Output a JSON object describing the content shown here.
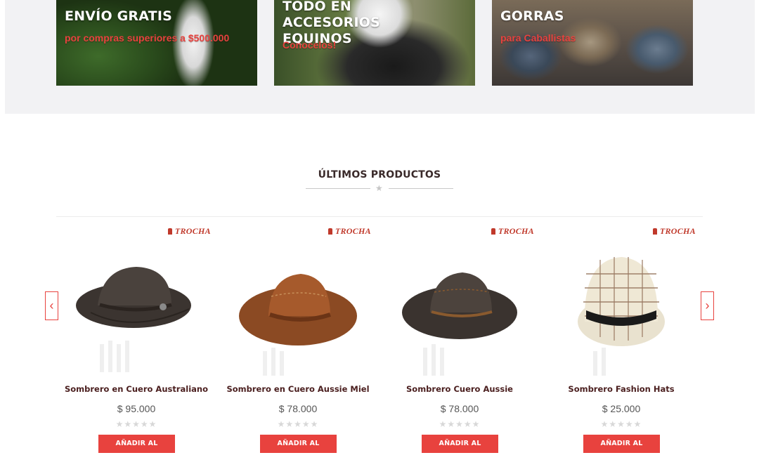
{
  "promos": [
    {
      "title": "ENVÍO GRATIS",
      "subtitle": "por compras superiores a $500.000"
    },
    {
      "title": "TODO EN ACCESORIOS EQUINOS",
      "subtitle": "Conocelos!"
    },
    {
      "title": "GORRAS",
      "subtitle": "para Caballistas"
    }
  ],
  "section": {
    "title": "ÚLTIMOS PRODUCTOS"
  },
  "carousel": {
    "prev_icon": "chevron-left-icon",
    "next_icon": "chevron-right-icon",
    "prev_glyph": "‹",
    "next_glyph": "›"
  },
  "products": [
    {
      "brand": "TROCHA",
      "name": "Sombrero en Cuero Australiano",
      "price": "$ 95.000",
      "rating": 0,
      "stars": "★★★★★",
      "cart_label": "AÑADIR AL CARRITO"
    },
    {
      "brand": "TROCHA",
      "name": "Sombrero en Cuero Aussie Miel",
      "price": "$ 78.000",
      "rating": 0,
      "stars": "★★★★★",
      "cart_label": "AÑADIR AL CARRITO"
    },
    {
      "brand": "TROCHA",
      "name": "Sombrero Cuero Aussie",
      "price": "$ 78.000",
      "rating": 0,
      "stars": "★★★★★",
      "cart_label": "AÑADIR AL CARRITO"
    },
    {
      "brand": "TROCHA",
      "name": "Sombrero Fashion Hats",
      "price": "$ 25.000",
      "rating": 0,
      "stars": "★★★★★",
      "cart_label": "AÑADIR AL CARRITO"
    }
  ],
  "colors": {
    "accent": "#e8423e",
    "heading": "#3a2a2a",
    "product_name": "#4a1e1e",
    "banner_bg": "#f2f2f4"
  }
}
